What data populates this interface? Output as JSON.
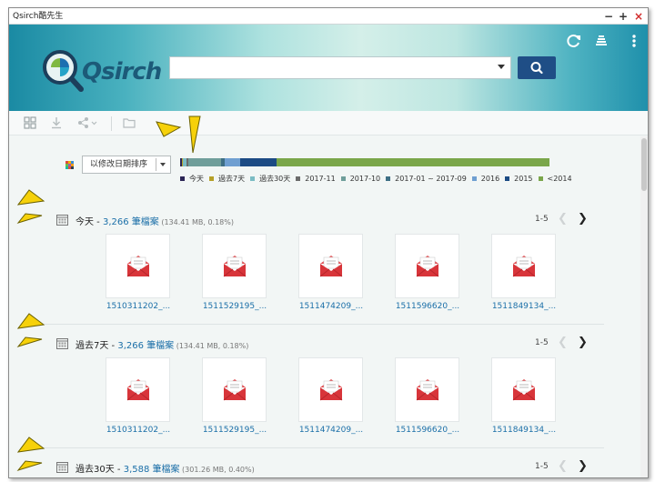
{
  "window": {
    "title": "Qsirch酷先生"
  },
  "header": {
    "logo_text": "Qsirch",
    "search": {
      "value": "",
      "placeholder": ""
    }
  },
  "sort": {
    "label": "以修改日期排序"
  },
  "timeline": {
    "segments": [
      {
        "label": "今天",
        "color": "#2b2555",
        "fraction": 0.005
      },
      {
        "label": "過去7天",
        "color": "#b5a028",
        "fraction": 0.002
      },
      {
        "label": "過去30天",
        "color": "#7bbcc4",
        "fraction": 0.01
      },
      {
        "label": "2017-11",
        "color": "#6b6b6b",
        "fraction": 0.005
      },
      {
        "label": "2017-10",
        "color": "#6f9e9a",
        "fraction": 0.09
      },
      {
        "label": "2017-01 ~ 2017-09",
        "color": "#3e6f85",
        "fraction": 0.01
      },
      {
        "label": "2016",
        "color": "#6f9fd1",
        "fraction": 0.04
      },
      {
        "label": "2015",
        "color": "#1c4b84",
        "fraction": 0.1
      },
      {
        "label": "<2014",
        "color": "#7aa64a",
        "fraction": 0.738
      }
    ]
  },
  "groups": [
    {
      "title": "今天",
      "sep": " - ",
      "count": "3,266 筆檔案",
      "meta": " (134.41 MB, 0.18%)",
      "page": "1-5",
      "files": [
        "1510311202_...",
        "1511529195_...",
        "1511474209_...",
        "1511596620_...",
        "1511849134_..."
      ]
    },
    {
      "title": "過去7天",
      "sep": " - ",
      "count": "3,266 筆檔案",
      "meta": " (134.41 MB, 0.18%)",
      "page": "1-5",
      "files": [
        "1510311202_...",
        "1511529195_...",
        "1511474209_...",
        "1511596620_...",
        "1511849134_..."
      ]
    },
    {
      "title": "過去30天",
      "sep": " - ",
      "count": "3,588 筆檔案",
      "meta": " (301.26 MB, 0.40%)",
      "page": "1-5",
      "files": []
    }
  ],
  "colors": {
    "accent": "#1f4e86",
    "link": "#1b6fa8",
    "mail_red": "#d8353a",
    "arrow_yellow": "#f6d10a"
  },
  "icons": [
    "refresh-icon",
    "stack-icon",
    "more-icon",
    "grid-view-icon",
    "download-icon",
    "share-icon",
    "folder-icon",
    "calendar-icon",
    "mail-icon",
    "search-icon"
  ]
}
